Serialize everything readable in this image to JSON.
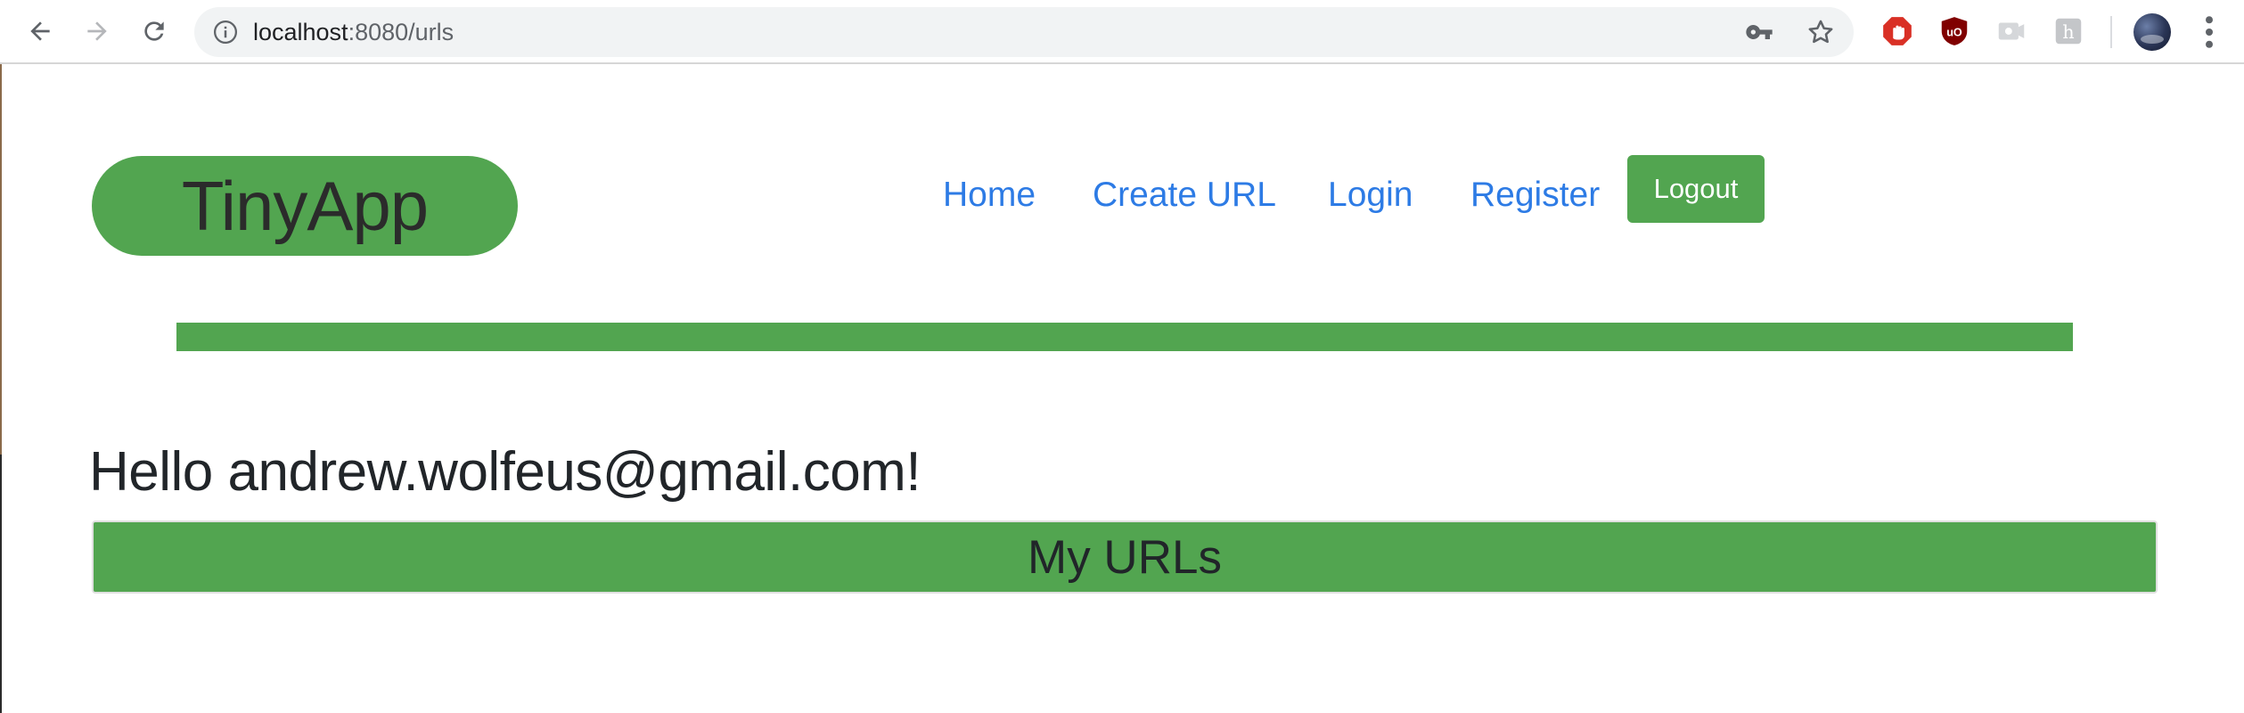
{
  "browser": {
    "url_host": "localhost",
    "url_rest": ":8080/urls"
  },
  "header": {
    "brand": "TinyApp",
    "nav": [
      {
        "label": "Home"
      },
      {
        "label": "Create URL"
      },
      {
        "label": "Login"
      },
      {
        "label": "Register"
      }
    ],
    "logout_label": "Logout"
  },
  "main": {
    "greeting": "Hello andrew.wolfeus@gmail.com!",
    "section_title": "My URLs"
  },
  "colors": {
    "accent_green": "#52a550",
    "link_blue": "#2d7be5",
    "text_dark": "#212529"
  }
}
